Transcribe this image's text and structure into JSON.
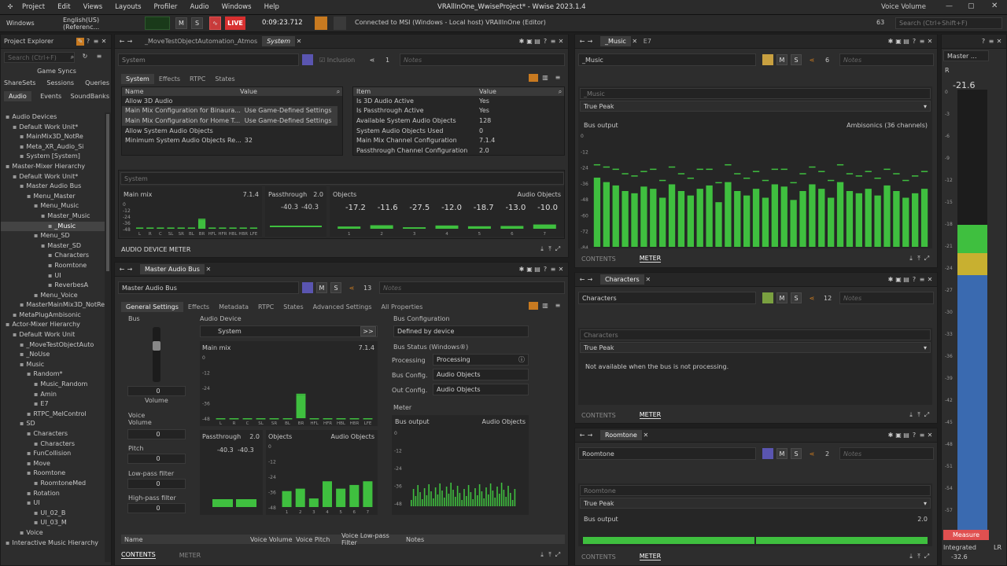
{
  "app": {
    "title": "VRAllInOne_WwiseProject* - Wwise 2023.1.4",
    "menu": [
      "Project",
      "Edit",
      "Views",
      "Layouts",
      "Profiler",
      "Audio",
      "Windows",
      "Help"
    ],
    "voice_volume": "Voice Volume"
  },
  "toolbar": {
    "platform": "Windows",
    "language": "English(US) (Referenc...",
    "m": "M",
    "s": "S",
    "live": "LIVE",
    "time": "0:09:23.712",
    "connection": "Connected to MSI (Windows - Local host) VRAllInOne (Editor)",
    "count": "63",
    "search_placeholder": "Search (Ctrl+Shift+F)"
  },
  "explorer": {
    "title": "Project Explorer",
    "search_placeholder": "Search (Ctrl+F)",
    "tabs1": [
      "Game Syncs"
    ],
    "tabs2": [
      "ShareSets",
      "Sessions",
      "Queries"
    ],
    "tabs3": [
      "Audio",
      "Events",
      "SoundBanks"
    ],
    "tree": [
      "Audio Devices",
      "Default Work Unit*",
      "MainMix3D_NotRe",
      "Meta_XR_Audio_Si",
      "System [System]",
      "Master-Mixer Hierarchy",
      "Default Work Unit*",
      "Master Audio Bus",
      "Menu_Master",
      "Menu_Music",
      "Master_Music",
      "_Music",
      "Menu_SD",
      "Master_SD",
      "Characters",
      "Roomtone",
      "UI",
      "ReverbesA",
      "Menu_Voice",
      "MasterMainMix3D_NotRe",
      "MetaPlugAmbisonic",
      "Actor-Mixer Hierarchy",
      "Default Work Unit",
      "_MoveTestObjectAuto",
      "_NoUse",
      "Music",
      "Random*",
      "Music_Random",
      "Amin",
      "E7",
      "RTPC_MelControl",
      "SD",
      "Characters",
      "Characters",
      "FunCollision",
      "Move",
      "Roomtone",
      "RoomtoneMed",
      "Rotation",
      "UI",
      "UI_02_B",
      "UI_03_M",
      "Voice",
      "Interactive Music Hierarchy"
    ]
  },
  "sys": {
    "tab1": "_MoveTestObjectAutomation_Atmos",
    "tab2": "System",
    "name": "System",
    "inclusion": "Inclusion",
    "refcount": "1",
    "notes": "Notes",
    "tabs": [
      "System",
      "Effects",
      "RTPC",
      "States"
    ],
    "left_head": [
      "Name",
      "Value"
    ],
    "left_rows": [
      [
        "Allow 3D Audio",
        ""
      ],
      [
        "Main Mix Configuration for Binaura...",
        "Use Game-Defined Settings"
      ],
      [
        "Main Mix Configuration for Home T...",
        "Use Game-Defined Settings"
      ],
      [
        "Allow System Audio Objects",
        ""
      ],
      [
        "Minimum System Audio Objects Re...",
        "32"
      ]
    ],
    "right_head": [
      "Item",
      "Value"
    ],
    "right_rows": [
      [
        "Is 3D Audio Active",
        "Yes"
      ],
      [
        "Is Passthrough Active",
        "Yes"
      ],
      [
        "Available System Audio Objects",
        "128"
      ],
      [
        "System Audio Objects Used",
        "0"
      ],
      [
        "Main Mix Channel Configuration",
        "7.1.4"
      ],
      [
        "Passthrough Channel Configuration",
        "2.0"
      ]
    ],
    "meter_name": "System",
    "mainmix": "Main mix",
    "mainmix_cfg": "7.1.4",
    "pass": "Passthrough",
    "pass_cfg": "2.0",
    "objects": "Objects",
    "objects_cfg": "Audio Objects",
    "pass_vals": [
      "-40.3",
      "-40.3"
    ],
    "obj_vals": [
      "-17.2",
      "-11.6",
      "-27.5",
      "-12.0",
      "-18.7",
      "-13.0",
      "-10.0"
    ],
    "footer": "AUDIO DEVICE METER",
    "mm_labels": [
      "L",
      "R",
      "C",
      "SL",
      "SR",
      "BL",
      "BR",
      "HFL",
      "HFR",
      "HBL",
      "HBR",
      "LFE"
    ],
    "mm_levels": [
      0.02,
      0.02,
      0.02,
      0.02,
      0.02,
      0.02,
      0.35,
      0.02,
      0.02,
      0.02,
      0.02,
      0.02
    ],
    "mm_peaks": [
      0.05,
      0.05,
      0.05,
      0.05,
      0.05,
      0.05,
      0.4,
      0.05,
      0.05,
      0.05,
      0.05,
      0.05
    ],
    "obj_labels": [
      "1",
      "2",
      "3",
      "4",
      "5",
      "6",
      "7"
    ],
    "obj_levels": [
      0.18,
      0.28,
      0.12,
      0.26,
      0.2,
      0.22,
      0.34
    ],
    "y_ticks": [
      "0",
      "-12",
      "-24",
      "-36",
      "-48"
    ]
  },
  "bus": {
    "tab": "Master Audio Bus",
    "name": "Master Audio Bus",
    "count": "13",
    "notes": "Notes",
    "tabs": [
      "General Settings",
      "Effects",
      "Metadata",
      "RTPC",
      "States",
      "Advanced Settings",
      "All Properties"
    ],
    "bus_label": "Bus",
    "volume": "Volume",
    "vol_val": "0",
    "voice_volume": "Voice Volume",
    "vv_val": "0",
    "pitch": "Pitch",
    "pitch_val": "0",
    "lpf": "Low-pass filter",
    "lpf_val": "0",
    "hpf": "High-pass filter",
    "hpf_val": "0",
    "audio_device": "Audio Device",
    "device": "System",
    "bus_config": "Bus Configuration",
    "bus_config_val": "Defined by device",
    "status": "Bus Status (Windows®)",
    "processing": "Processing",
    "processing_val": "Processing",
    "bconfig": "Bus Config.",
    "bconfig_val": "Audio Objects",
    "oconfig": "Out Config.",
    "oconfig_val": "Audio Objects",
    "meter": "Meter",
    "bus_output": "Bus output",
    "bus_output_val": "Audio Objects",
    "mainmix": "Main mix",
    "mainmix_cfg": "7.1.4",
    "pass": "Passthrough",
    "pass_cfg": "2.0",
    "pass_vals": [
      "-40.3",
      "-40.3"
    ],
    "objects": "Objects",
    "objects_cfg": "Audio Objects",
    "mm_labels": [
      "L",
      "R",
      "C",
      "SL",
      "SR",
      "BL",
      "BR",
      "HFL",
      "HFR",
      "HBL",
      "HBR",
      "LFE"
    ],
    "mm_peaks": [
      0.0,
      0.0,
      0.0,
      0.0,
      0.0,
      0.0,
      0.4,
      0.0,
      0.0,
      0.0,
      0.0,
      0.0
    ],
    "mm_levels": [
      0,
      0,
      0,
      0,
      0,
      0,
      0.38,
      0,
      0,
      0,
      0,
      0
    ],
    "obj_labels": [
      "1",
      "2",
      "3",
      "4",
      "5",
      "6",
      "7"
    ],
    "obj_levels": [
      0.26,
      0.3,
      0.14,
      0.42,
      0.3,
      0.36,
      0.42
    ],
    "y_ticks": [
      "0",
      "-12",
      "-24",
      "-36",
      "-48"
    ],
    "y_ticks2": [
      "0",
      "-12",
      "-24",
      "-36",
      "-48"
    ],
    "list_head": [
      "Name",
      "Voice Volume",
      "Voice Pitch",
      "Voice Low-pass Filter",
      "Notes"
    ],
    "contents": "CONTENTS",
    "meter_tab": "METER"
  },
  "music": {
    "tab1": "_Music",
    "tab2": "E7",
    "name": "_Music",
    "count": "6",
    "notes": "Notes",
    "meter_name": "_Music",
    "mode": "True Peak",
    "bus_output": "Bus output",
    "cfg": "Ambisonics (36 channels)",
    "y_ticks": [
      "0",
      "-12",
      "-24",
      "-36",
      "-48",
      "-60",
      "-72",
      "-84"
    ],
    "contents": "CONTENTS",
    "meter_tab": "METER",
    "levels": [
      0.62,
      0.58,
      0.55,
      0.5,
      0.48,
      0.54,
      0.52,
      0.44,
      0.56,
      0.5,
      0.46,
      0.52,
      0.55,
      0.4,
      0.58,
      0.5,
      0.46,
      0.52,
      0.44,
      0.56,
      0.54,
      0.42,
      0.5,
      0.56,
      0.52,
      0.44,
      0.58,
      0.5,
      0.48,
      0.52,
      0.46,
      0.55,
      0.5,
      0.44,
      0.48,
      0.52
    ],
    "peaks": [
      0.74,
      0.72,
      0.7,
      0.66,
      0.64,
      0.68,
      0.7,
      0.6,
      0.72,
      0.66,
      0.62,
      0.7,
      0.7,
      0.58,
      0.74,
      0.66,
      0.62,
      0.68,
      0.6,
      0.7,
      0.7,
      0.58,
      0.66,
      0.72,
      0.68,
      0.6,
      0.74,
      0.66,
      0.64,
      0.68,
      0.62,
      0.7,
      0.66,
      0.6,
      0.64,
      0.68
    ]
  },
  "chars": {
    "tab": "Characters",
    "name": "Characters",
    "count": "12",
    "notes": "Notes",
    "meter_name": "Characters",
    "mode": "True Peak",
    "msg": "Not available when the bus is not processing.",
    "contents": "CONTENTS",
    "meter_tab": "METER"
  },
  "room": {
    "tab": "Roomtone",
    "name": "Roomtone",
    "count": "2",
    "notes": "Notes",
    "meter_name": "Roomtone",
    "mode": "True Peak",
    "bus_output": "Bus output",
    "cfg": "2.0",
    "contents": "CONTENTS",
    "meter_tab": "METER"
  },
  "loud": {
    "value": "-21.6",
    "ticks": [
      "0",
      "-3",
      "-6",
      "-9",
      "-12",
      "-15",
      "-18",
      "-21",
      "-24",
      "-27",
      "-30",
      "-33",
      "-36",
      "-39",
      "-42",
      "-45",
      "-48",
      "-51",
      "-54",
      "-57"
    ],
    "measure": "Measure",
    "integrated": "Integrated",
    "integrated_val": "-32.6",
    "master": "Master ...",
    "lr": "LR"
  }
}
